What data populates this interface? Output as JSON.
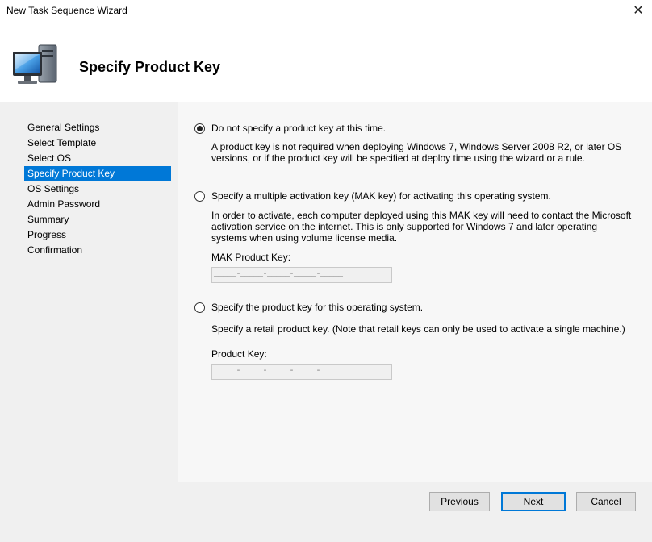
{
  "window": {
    "title": "New Task Sequence Wizard"
  },
  "header": {
    "title": "Specify Product Key",
    "icon": "computer-icon"
  },
  "sidebar": {
    "items": [
      {
        "label": "General Settings",
        "active": false
      },
      {
        "label": "Select Template",
        "active": false
      },
      {
        "label": "Select OS",
        "active": false
      },
      {
        "label": "Specify Product Key",
        "active": true
      },
      {
        "label": "OS Settings",
        "active": false
      },
      {
        "label": "Admin Password",
        "active": false
      },
      {
        "label": "Summary",
        "active": false
      },
      {
        "label": "Progress",
        "active": false
      },
      {
        "label": "Confirmation",
        "active": false
      }
    ]
  },
  "options": [
    {
      "label": "Do not specify a product key at this time.",
      "selected": true,
      "description": "A product key is not required when deploying Windows 7, Windows Server 2008 R2, or later OS versions, or if the product key will be specified at deploy time using the wizard or a rule."
    },
    {
      "label": "Specify a multiple activation key (MAK key) for activating this operating system.",
      "selected": false,
      "description": "In order to activate, each computer deployed using this MAK key will need to contact the Microsoft activation service on the internet.  This is only supported for Windows 7 and later operating systems when using volume license media.",
      "field_label": "MAK Product Key:",
      "field_mask": "_____-_____-_____-_____-_____"
    },
    {
      "label": "Specify the product key for this operating system.",
      "selected": false,
      "description": "Specify a retail product key.  (Note that retail keys can only be used to activate a single machine.)",
      "field_label": "Product Key:",
      "field_mask": "_____-_____-_____-_____-_____"
    }
  ],
  "footer": {
    "previous_label": "Previous",
    "next_label": "Next",
    "cancel_label": "Cancel"
  },
  "colors": {
    "accent": "#0078d7",
    "sidebar_bg": "#f0f0f0",
    "content_bg": "#f7f7f7"
  }
}
